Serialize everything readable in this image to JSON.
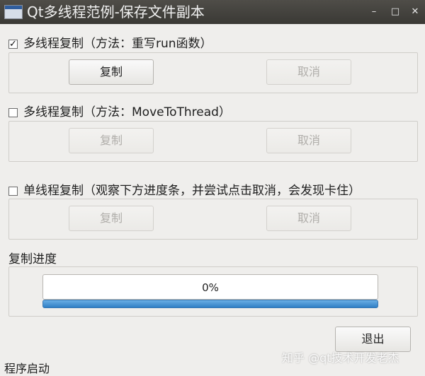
{
  "window": {
    "title": "Qt多线程范例-保存文件副本",
    "minimize_glyph": "–",
    "maximize_glyph": "□",
    "close_glyph": "✕"
  },
  "groups": [
    {
      "checked": true,
      "check_mark": "✓",
      "label": "多线程复制（方法：重写run函数）",
      "copy_label": "复制",
      "cancel_label": "取消",
      "copy_enabled": true,
      "cancel_enabled": false
    },
    {
      "checked": false,
      "check_mark": "",
      "label": "多线程复制（方法：MoveToThread）",
      "copy_label": "复制",
      "cancel_label": "取消",
      "copy_enabled": false,
      "cancel_enabled": false
    },
    {
      "checked": false,
      "check_mark": "",
      "label": "单线程复制（观察下方进度条，并尝试点击取消，会发现卡住）",
      "copy_label": "复制",
      "cancel_label": "取消",
      "copy_enabled": false,
      "cancel_enabled": false
    }
  ],
  "progress": {
    "group_label": "复制进度",
    "text": "0%",
    "value_percent": 0
  },
  "exit_label": "退出",
  "status_text": "程序启动",
  "watermark": "知乎 @qt技术开发老杰",
  "colors": {
    "titlebar": "#3f3e3a",
    "window_bg": "#efeeec",
    "progress_blue": "#2f7fc4"
  }
}
